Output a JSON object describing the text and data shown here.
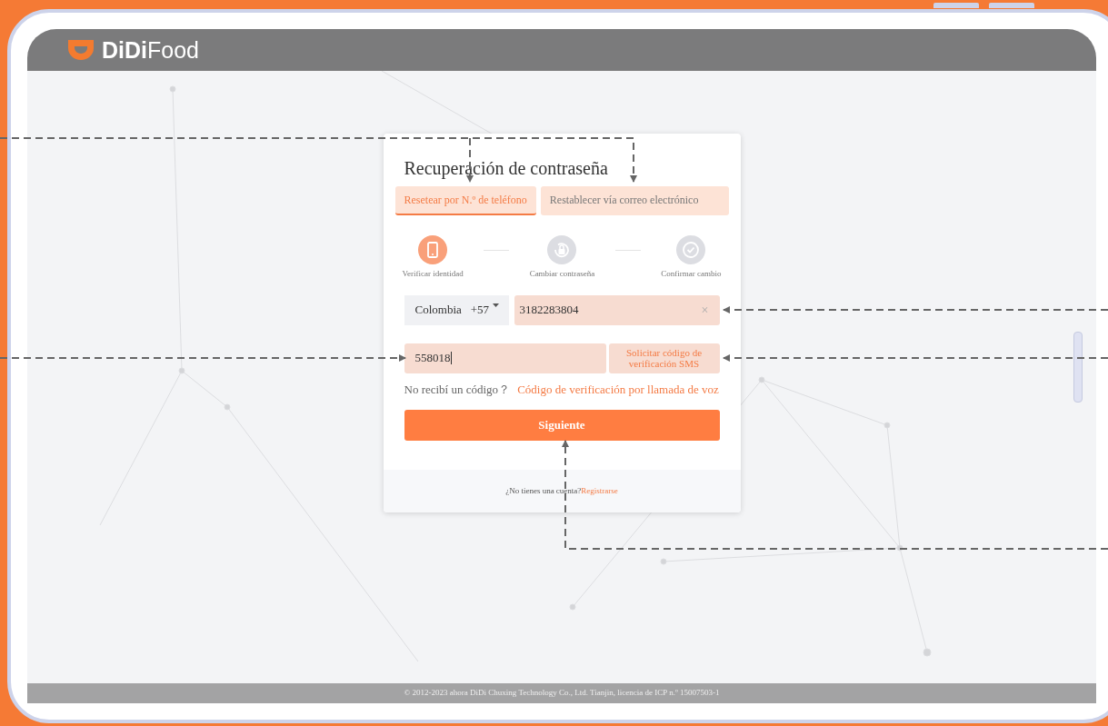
{
  "header": {
    "logo_brand": "DiDi",
    "logo_product": "Food"
  },
  "card": {
    "title": "Recuperación de contraseña",
    "tabs": [
      {
        "label": "Resetear por N.º de teléfono",
        "selected": true
      },
      {
        "label": "Restablecer vía correo electrónico",
        "selected": false
      }
    ],
    "steps": [
      {
        "label": "Verificar identidad",
        "kind": "phone",
        "active": true
      },
      {
        "label": "Cambiar contraseña",
        "kind": "lock",
        "active": false
      },
      {
        "label": "Confirmar cambio",
        "kind": "check",
        "active": false
      }
    ],
    "phone": {
      "country": "Colombia",
      "code": "+57",
      "value": "3182283804",
      "clear": "×"
    },
    "code_field": {
      "value": "558018"
    },
    "sms_button": "Solicitar código de verificación SMS",
    "hint": "No recibí un código？",
    "voice_link": "Código de verificación por llamada de voz",
    "next_button": "Siguiente",
    "signup_text": "¿No tienes una cuenta?",
    "signup_link": "Registrarse"
  },
  "footer": "© 2012-2023 ahora DiDi Chuxing Technology Co., Ltd. Tianjin, licencia de ICP n.º 15007503-1"
}
